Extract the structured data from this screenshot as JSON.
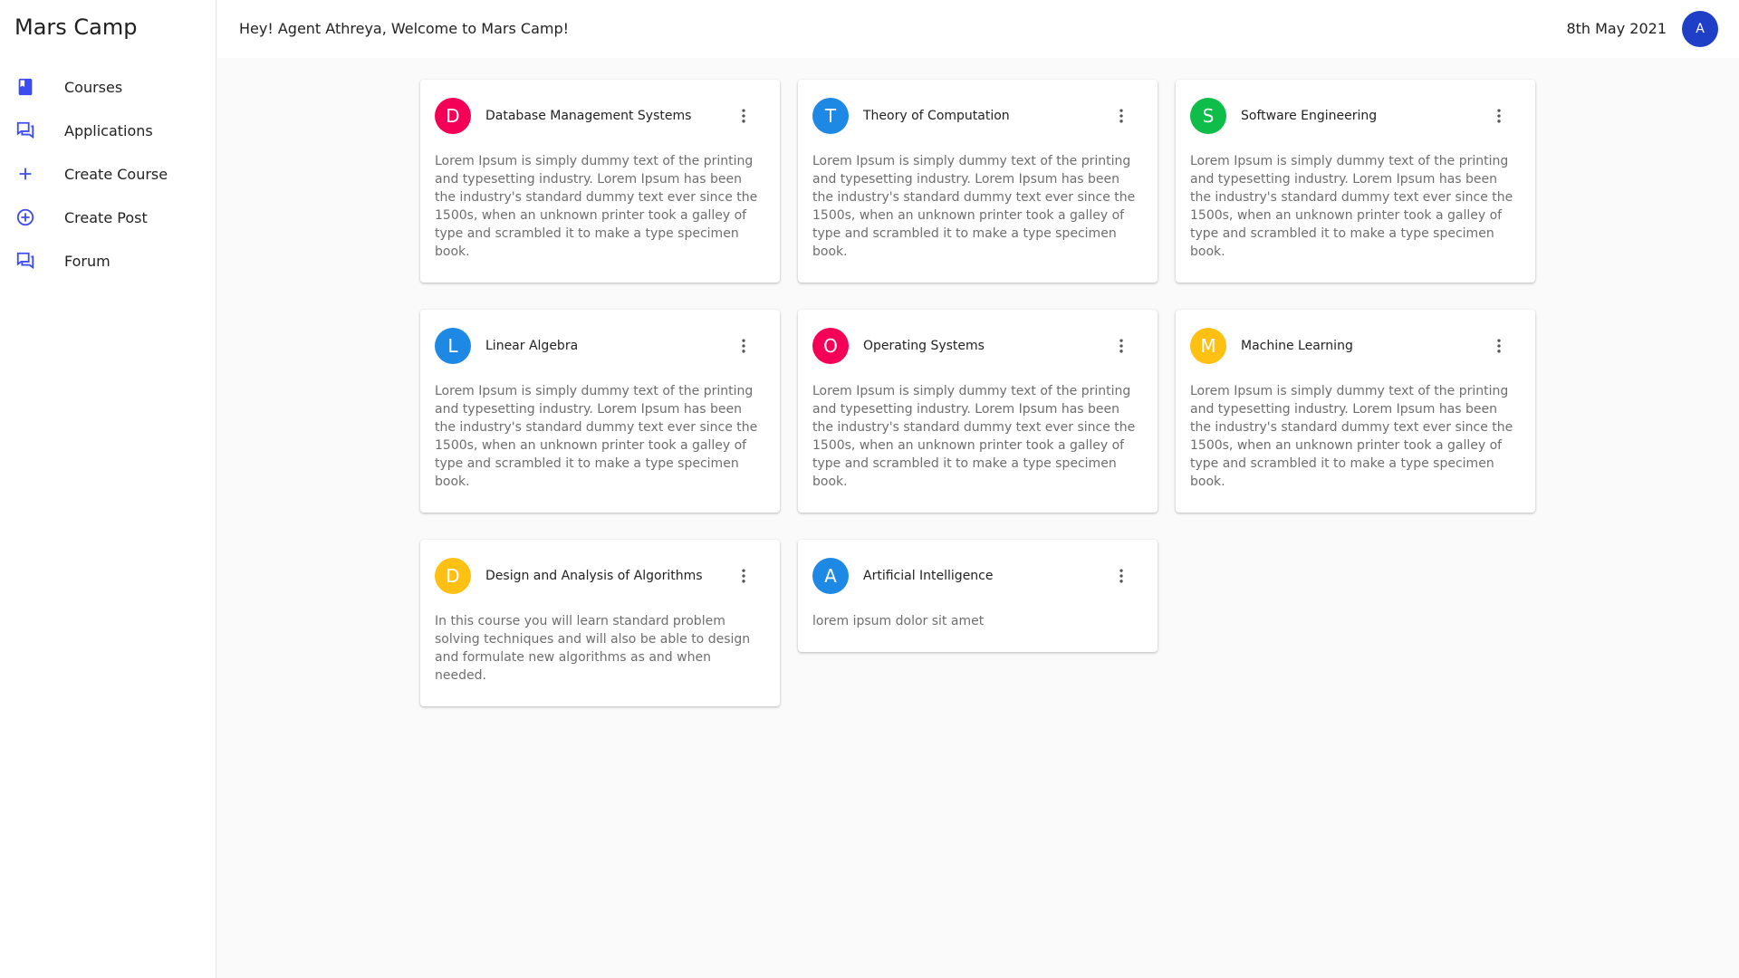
{
  "app": {
    "title": "Mars Camp"
  },
  "sidebar": {
    "items": [
      {
        "label": "Courses",
        "icon": "book-icon"
      },
      {
        "label": "Applications",
        "icon": "forum-icon"
      },
      {
        "label": "Create Course",
        "icon": "plus-icon"
      },
      {
        "label": "Create Post",
        "icon": "add-circle-icon"
      },
      {
        "label": "Forum",
        "icon": "forum-icon"
      }
    ]
  },
  "header": {
    "welcome": "Hey! Agent Athreya, Welcome to Mars Camp!",
    "date": "8th May 2021",
    "avatar_letter": "A"
  },
  "colors": {
    "accent": "#3d4cf0",
    "pink": "#f50057",
    "blue": "#1e88e5",
    "green": "#0fbd4a",
    "yellow": "#fdc013",
    "avatar": "#1e3fc6"
  },
  "courses": [
    {
      "letter": "D",
      "title": "Database Management Systems",
      "color": "#f50057",
      "description": "Lorem Ipsum is simply dummy text of the printing and typesetting industry. Lorem Ipsum has been the industry's standard dummy text ever since the 1500s, when an unknown printer took a galley of type and scrambled it to make a type specimen book."
    },
    {
      "letter": "T",
      "title": "Theory of Computation",
      "color": "#1e88e5",
      "description": "Lorem Ipsum is simply dummy text of the printing and typesetting industry. Lorem Ipsum has been the industry's standard dummy text ever since the 1500s, when an unknown printer took a galley of type and scrambled it to make a type specimen book."
    },
    {
      "letter": "S",
      "title": "Software Engineering",
      "color": "#0fbd4a",
      "description": "Lorem Ipsum is simply dummy text of the printing and typesetting industry. Lorem Ipsum has been the industry's standard dummy text ever since the 1500s, when an unknown printer took a galley of type and scrambled it to make a type specimen book."
    },
    {
      "letter": "L",
      "title": "Linear Algebra",
      "color": "#1e88e5",
      "description": "Lorem Ipsum is simply dummy text of the printing and typesetting industry. Lorem Ipsum has been the industry's standard dummy text ever since the 1500s, when an unknown printer took a galley of type and scrambled it to make a type specimen book."
    },
    {
      "letter": "O",
      "title": "Operating Systems",
      "color": "#f50057",
      "description": "Lorem Ipsum is simply dummy text of the printing and typesetting industry. Lorem Ipsum has been the industry's standard dummy text ever since the 1500s, when an unknown printer took a galley of type and scrambled it to make a type specimen book."
    },
    {
      "letter": "M",
      "title": "Machine Learning",
      "color": "#fdc013",
      "description": "Lorem Ipsum is simply dummy text of the printing and typesetting industry. Lorem Ipsum has been the industry's standard dummy text ever since the 1500s, when an unknown printer took a galley of type and scrambled it to make a type specimen book."
    },
    {
      "letter": "D",
      "title": "Design and Analysis of Algorithms",
      "color": "#fdc013",
      "description": "In this course you will learn standard problem solving techniques and will also be able to design and formulate new algorithms as and when needed."
    },
    {
      "letter": "A",
      "title": "Artificial Intelligence",
      "color": "#1e88e5",
      "description": "lorem ipsum dolor sit amet"
    }
  ]
}
